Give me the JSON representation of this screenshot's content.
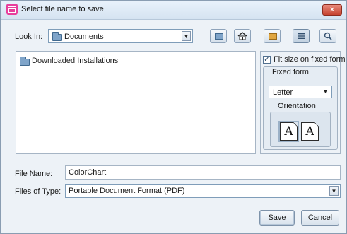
{
  "window": {
    "title": "Select file name to save",
    "close_label": "✕"
  },
  "look_in": {
    "label": "Look In:",
    "value": "Documents"
  },
  "toolbar": {
    "icons": [
      "up-folder-icon",
      "home-icon",
      "new-folder-icon",
      "list-view-icon",
      "details-view-icon"
    ]
  },
  "file_list": {
    "items": [
      {
        "name": "Downloaded Installations",
        "icon": "folder-icon"
      }
    ]
  },
  "options": {
    "fit_size_label": "Fit size on fixed form",
    "fit_size_checked": true,
    "fixed_form_label": "Fixed form",
    "paper_value": "Letter",
    "orientation_label": "Orientation",
    "portrait_glyph": "A",
    "landscape_glyph": "A"
  },
  "file_name": {
    "label": "File Name:",
    "value": "ColorChart"
  },
  "files_of_type": {
    "label": "Files of Type:",
    "value": "Portable Document Format (PDF)"
  },
  "buttons": {
    "save": "Save",
    "cancel_prefix": "",
    "cancel_mnemonic": "C",
    "cancel_rest": "ancel"
  }
}
